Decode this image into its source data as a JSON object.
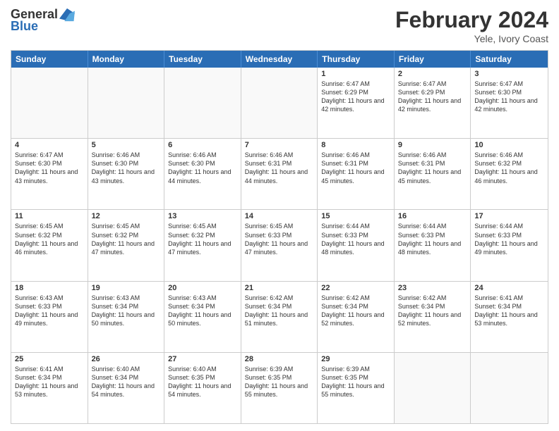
{
  "header": {
    "logo_line1": "General",
    "logo_line2": "Blue",
    "month_title": "February 2024",
    "location": "Yele, Ivory Coast"
  },
  "days_of_week": [
    "Sunday",
    "Monday",
    "Tuesday",
    "Wednesday",
    "Thursday",
    "Friday",
    "Saturday"
  ],
  "weeks": [
    [
      {
        "day": "",
        "info": ""
      },
      {
        "day": "",
        "info": ""
      },
      {
        "day": "",
        "info": ""
      },
      {
        "day": "",
        "info": ""
      },
      {
        "day": "1",
        "info": "Sunrise: 6:47 AM\nSunset: 6:29 PM\nDaylight: 11 hours and 42 minutes."
      },
      {
        "day": "2",
        "info": "Sunrise: 6:47 AM\nSunset: 6:29 PM\nDaylight: 11 hours and 42 minutes."
      },
      {
        "day": "3",
        "info": "Sunrise: 6:47 AM\nSunset: 6:30 PM\nDaylight: 11 hours and 42 minutes."
      }
    ],
    [
      {
        "day": "4",
        "info": "Sunrise: 6:47 AM\nSunset: 6:30 PM\nDaylight: 11 hours and 43 minutes."
      },
      {
        "day": "5",
        "info": "Sunrise: 6:46 AM\nSunset: 6:30 PM\nDaylight: 11 hours and 43 minutes."
      },
      {
        "day": "6",
        "info": "Sunrise: 6:46 AM\nSunset: 6:30 PM\nDaylight: 11 hours and 44 minutes."
      },
      {
        "day": "7",
        "info": "Sunrise: 6:46 AM\nSunset: 6:31 PM\nDaylight: 11 hours and 44 minutes."
      },
      {
        "day": "8",
        "info": "Sunrise: 6:46 AM\nSunset: 6:31 PM\nDaylight: 11 hours and 45 minutes."
      },
      {
        "day": "9",
        "info": "Sunrise: 6:46 AM\nSunset: 6:31 PM\nDaylight: 11 hours and 45 minutes."
      },
      {
        "day": "10",
        "info": "Sunrise: 6:46 AM\nSunset: 6:32 PM\nDaylight: 11 hours and 46 minutes."
      }
    ],
    [
      {
        "day": "11",
        "info": "Sunrise: 6:45 AM\nSunset: 6:32 PM\nDaylight: 11 hours and 46 minutes."
      },
      {
        "day": "12",
        "info": "Sunrise: 6:45 AM\nSunset: 6:32 PM\nDaylight: 11 hours and 47 minutes."
      },
      {
        "day": "13",
        "info": "Sunrise: 6:45 AM\nSunset: 6:32 PM\nDaylight: 11 hours and 47 minutes."
      },
      {
        "day": "14",
        "info": "Sunrise: 6:45 AM\nSunset: 6:33 PM\nDaylight: 11 hours and 47 minutes."
      },
      {
        "day": "15",
        "info": "Sunrise: 6:44 AM\nSunset: 6:33 PM\nDaylight: 11 hours and 48 minutes."
      },
      {
        "day": "16",
        "info": "Sunrise: 6:44 AM\nSunset: 6:33 PM\nDaylight: 11 hours and 48 minutes."
      },
      {
        "day": "17",
        "info": "Sunrise: 6:44 AM\nSunset: 6:33 PM\nDaylight: 11 hours and 49 minutes."
      }
    ],
    [
      {
        "day": "18",
        "info": "Sunrise: 6:43 AM\nSunset: 6:33 PM\nDaylight: 11 hours and 49 minutes."
      },
      {
        "day": "19",
        "info": "Sunrise: 6:43 AM\nSunset: 6:34 PM\nDaylight: 11 hours and 50 minutes."
      },
      {
        "day": "20",
        "info": "Sunrise: 6:43 AM\nSunset: 6:34 PM\nDaylight: 11 hours and 50 minutes."
      },
      {
        "day": "21",
        "info": "Sunrise: 6:42 AM\nSunset: 6:34 PM\nDaylight: 11 hours and 51 minutes."
      },
      {
        "day": "22",
        "info": "Sunrise: 6:42 AM\nSunset: 6:34 PM\nDaylight: 11 hours and 52 minutes."
      },
      {
        "day": "23",
        "info": "Sunrise: 6:42 AM\nSunset: 6:34 PM\nDaylight: 11 hours and 52 minutes."
      },
      {
        "day": "24",
        "info": "Sunrise: 6:41 AM\nSunset: 6:34 PM\nDaylight: 11 hours and 53 minutes."
      }
    ],
    [
      {
        "day": "25",
        "info": "Sunrise: 6:41 AM\nSunset: 6:34 PM\nDaylight: 11 hours and 53 minutes."
      },
      {
        "day": "26",
        "info": "Sunrise: 6:40 AM\nSunset: 6:34 PM\nDaylight: 11 hours and 54 minutes."
      },
      {
        "day": "27",
        "info": "Sunrise: 6:40 AM\nSunset: 6:35 PM\nDaylight: 11 hours and 54 minutes."
      },
      {
        "day": "28",
        "info": "Sunrise: 6:39 AM\nSunset: 6:35 PM\nDaylight: 11 hours and 55 minutes."
      },
      {
        "day": "29",
        "info": "Sunrise: 6:39 AM\nSunset: 6:35 PM\nDaylight: 11 hours and 55 minutes."
      },
      {
        "day": "",
        "info": ""
      },
      {
        "day": "",
        "info": ""
      }
    ]
  ]
}
